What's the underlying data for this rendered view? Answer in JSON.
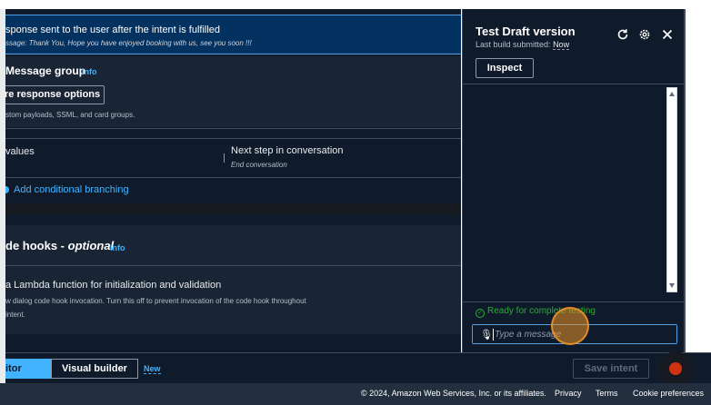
{
  "banner": {
    "line1": "sponse sent to the user after the intent is fulfilled",
    "line2": "ssage: Thank You, Hope you have enjoyed booking with us, see you soon !!!"
  },
  "message_group": {
    "title": "Message group",
    "info": "Info",
    "more_options_label": "re response options",
    "helper": "stom payloads, SSML, and card groups."
  },
  "values_row": {
    "left_label": "values",
    "next_step_label": "Next step in conversation",
    "next_step_value": "End conversation"
  },
  "conditional": {
    "link": "Add conditional branching"
  },
  "code_hooks": {
    "title_prefix": "de hooks - ",
    "title_optional": "optional",
    "info": "Info",
    "lambda_label": "a Lambda function for initialization and validation",
    "desc_line1": "w dialog code hook invocation. Turn this off to prevent invocation of the code hook throughout",
    "desc_line2": "intent."
  },
  "test_panel": {
    "title": "Test Draft version",
    "build_prefix": "Last build submitted: ",
    "build_value": "Now",
    "inspect": "Inspect",
    "status": "Ready for complete testing",
    "input_placeholder": "Type a message",
    "icons": {
      "refresh": "refresh-icon",
      "settings": "gear-icon",
      "close": "close-icon",
      "mic": "microphone-icon"
    }
  },
  "footer_tabs": {
    "editor": "itor",
    "visual_builder": "Visual builder",
    "new_badge": "New",
    "save": "Save intent"
  },
  "page_footer": {
    "copyright": "© 2024, Amazon Web Services, Inc. or its affiliates.",
    "privacy": "Privacy",
    "terms": "Terms",
    "cookies": "Cookie preferences"
  },
  "colors": {
    "background": "#0f1b2a",
    "section": "#192534",
    "accent": "#42b4ff",
    "success": "#29ad32",
    "record": "#d13212"
  }
}
